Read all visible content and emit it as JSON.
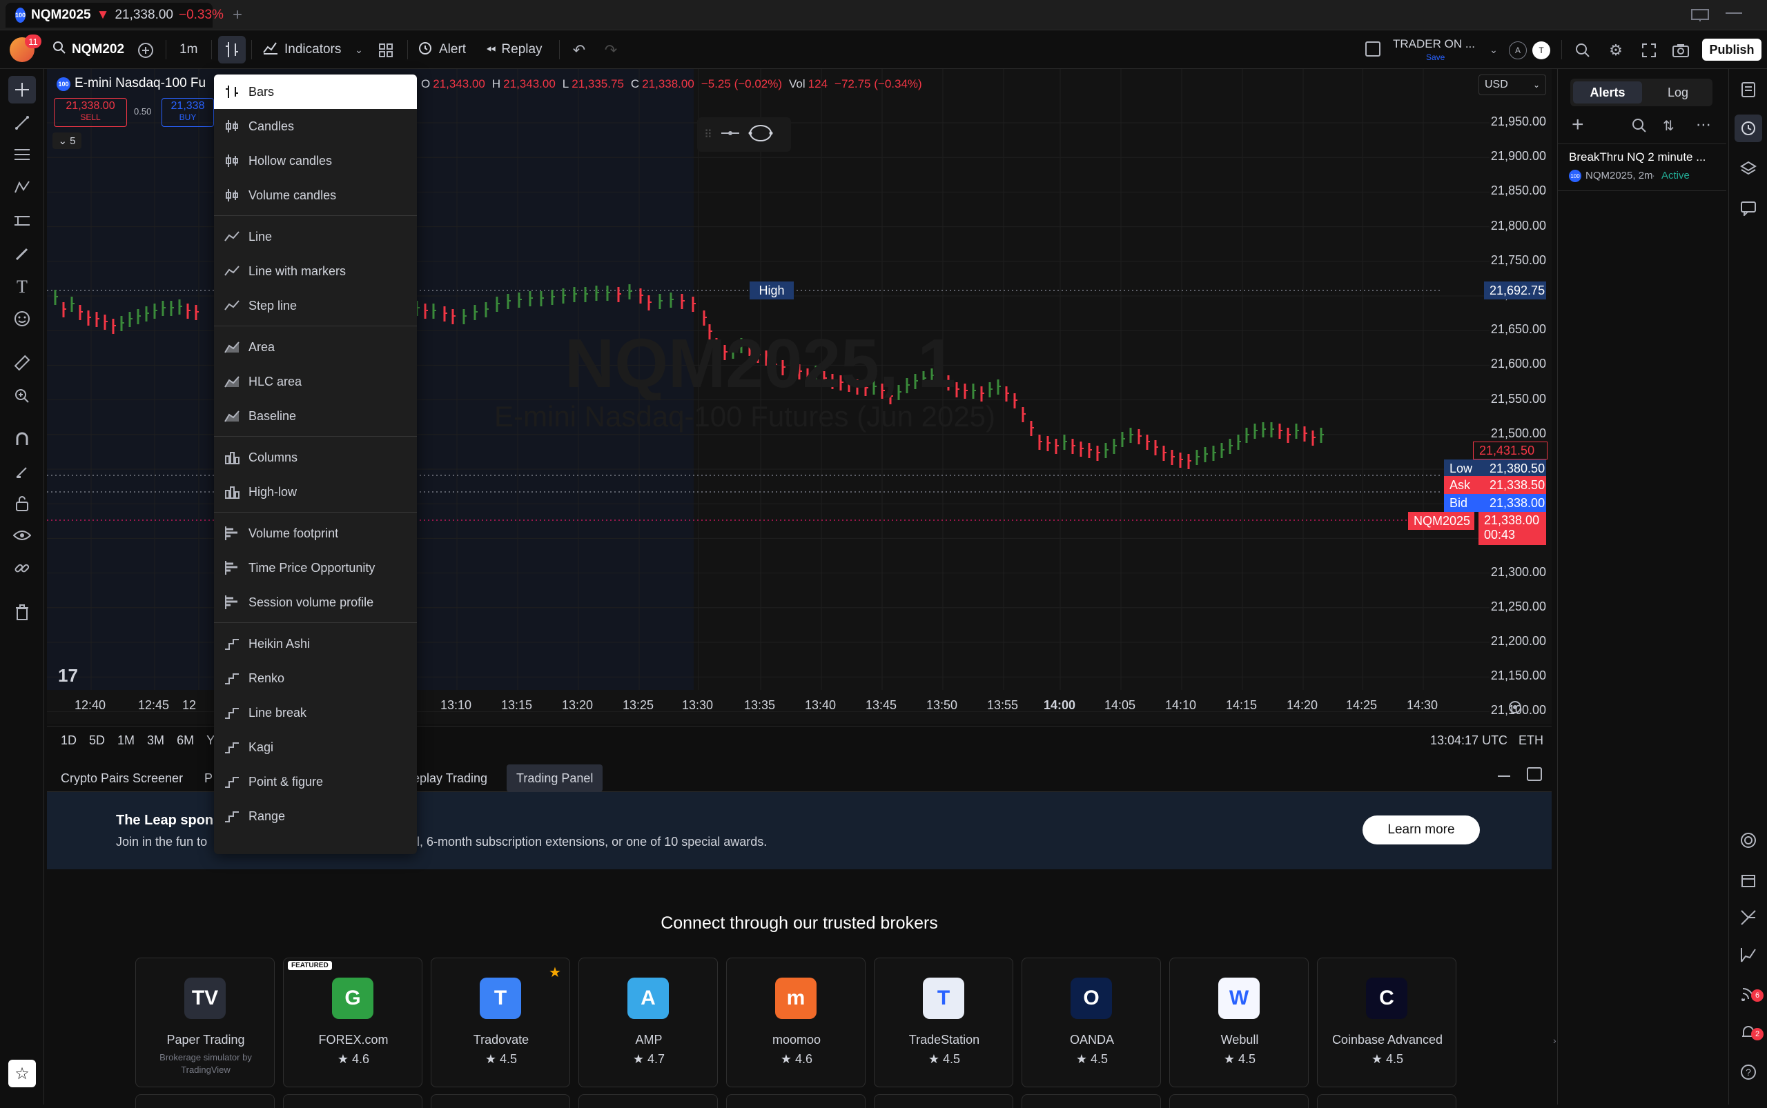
{
  "browser_tab": {
    "symbol": "NQM2025",
    "arrow": "▼",
    "price": "21,338.00",
    "change": "−0.33%",
    "badge": "100"
  },
  "topbar": {
    "avatar_badge": "11",
    "symbol": "NQM202",
    "interval": "1m",
    "indicators": "Indicators",
    "alert": "Alert",
    "replay": "Replay",
    "layout_name": "TRADER ON ...",
    "layout_save": "Save",
    "pill_a": "A",
    "pill_t": "T",
    "publish": "Publish"
  },
  "legend": {
    "badge": "100",
    "title": "E-mini Nasdaq-100 Fu",
    "ohlc_o_label": "O",
    "ohlc_o": "21,343.00",
    "ohlc_h_label": "H",
    "ohlc_h": "21,343.00",
    "ohlc_l_label": "L",
    "ohlc_l": "21,335.75",
    "ohlc_c_label": "C",
    "ohlc_c": "21,338.00",
    "change": "−5.25 (−0.02%)",
    "vol_label": "Vol",
    "vol": "124",
    "vol_change": "−72.75 (−0.34%)",
    "sell_price": "21,338.00",
    "sell_label": "SELL",
    "spread": "0.50",
    "buy_price": "21,338",
    "buy_label": "BUY",
    "collapse_count": "5",
    "currency": "USD",
    "watermark_symbol": "NQM2025, 1",
    "watermark_desc": "E-mini Nasdaq-100 Futures (Jun 2025)"
  },
  "price_axis": [
    "21,950.00",
    "21,900.00",
    "21,850.00",
    "21,800.00",
    "21,750.00",
    "21,700.00",
    "21,650.00",
    "21,600.00",
    "21,550.00",
    "21,500.00",
    "21,450.00",
    "21,400.00",
    "21,350.00",
    "21,300.00",
    "21,250.00",
    "21,200.00",
    "21,150.00",
    "21,100.00"
  ],
  "price_labels": {
    "high_label": "High",
    "high": "21,692.75",
    "alert_price": "21,431.50",
    "low_label": "Low",
    "low": "21,380.50",
    "ask_label": "Ask",
    "ask": "21,338.50",
    "bid_label": "Bid",
    "bid": "21,338.00",
    "sym_label": "NQM2025",
    "last": "21,338.00",
    "countdown": "00:43"
  },
  "time_axis": [
    "12:40",
    "12:45",
    "12",
    "13:10",
    "13:15",
    "13:20",
    "13:25",
    "13:30",
    "13:35",
    "13:40",
    "13:45",
    "13:50",
    "13:55",
    "14:00",
    "14:05",
    "14:10",
    "14:15",
    "14:20",
    "14:25",
    "14:30"
  ],
  "ranges": [
    "1D",
    "5D",
    "1M",
    "3M",
    "6M",
    "YT"
  ],
  "clock": "13:04:17 UTC",
  "session": "ETH",
  "chart_type_menu": {
    "groups": [
      [
        "Bars",
        "Candles",
        "Hollow candles",
        "Volume candles"
      ],
      [
        "Line",
        "Line with markers",
        "Step line"
      ],
      [
        "Area",
        "HLC area",
        "Baseline"
      ],
      [
        "Columns",
        "High-low"
      ],
      [
        "Volume footprint",
        "Time Price Opportunity",
        "Session volume profile"
      ],
      [
        "Heikin Ashi",
        "Renko",
        "Line break",
        "Kagi",
        "Point & figure",
        "Range"
      ]
    ]
  },
  "alerts_panel": {
    "tab_alerts": "Alerts",
    "tab_log": "Log",
    "alert_name": "BreakThru NQ 2 minute ...",
    "alert_badge": "100",
    "alert_symbol": "NQM2025, 2m",
    "alert_status": "Active"
  },
  "bottom_tabs": {
    "t1": "Crypto Pairs Screener",
    "t2": "P",
    "t3": "eplay Trading",
    "t4": "Trading Panel"
  },
  "banner": {
    "title": "The Leap spons",
    "text_left": "Join in the fun to",
    "text_right": "l, 6-month subscription extensions, or one of 10 special awards.",
    "cta": "Learn more"
  },
  "brokers_heading": "Connect through our trusted brokers",
  "brokers": [
    {
      "name": "Paper Trading",
      "sub1": "Brokerage simulator by",
      "sub2": "TradingView",
      "color": "#2a2e39",
      "glyph": "TV"
    },
    {
      "name": "FOREX.com",
      "rating": "4.6",
      "featured": "FEATURED",
      "color": "#2ea043",
      "glyph": "G"
    },
    {
      "name": "Tradovate",
      "rating": "4.5",
      "color": "#3b82f6",
      "glyph": "T"
    },
    {
      "name": "AMP",
      "rating": "4.7",
      "color": "#38a8e8",
      "glyph": "A"
    },
    {
      "name": "moomoo",
      "rating": "4.6",
      "color": "#f26b2a",
      "glyph": "m"
    },
    {
      "name": "TradeStation",
      "rating": "4.5",
      "color": "#e8edf7",
      "glyph": "T"
    },
    {
      "name": "OANDA",
      "rating": "4.5",
      "color": "#0b1f4a",
      "glyph": "O"
    },
    {
      "name": "Webull",
      "rating": "4.5",
      "color": "#f5f7ff",
      "glyph": "W"
    },
    {
      "name": "Coinbase Advanced",
      "rating": "4.5",
      "color": "#0a0b24",
      "glyph": "C"
    }
  ],
  "notif_badge": "2",
  "rss_badge": "6",
  "colors": {
    "up": "#3a8a3a",
    "down": "#f23645",
    "accent": "#2962ff",
    "bg": "#0f0f0f"
  }
}
